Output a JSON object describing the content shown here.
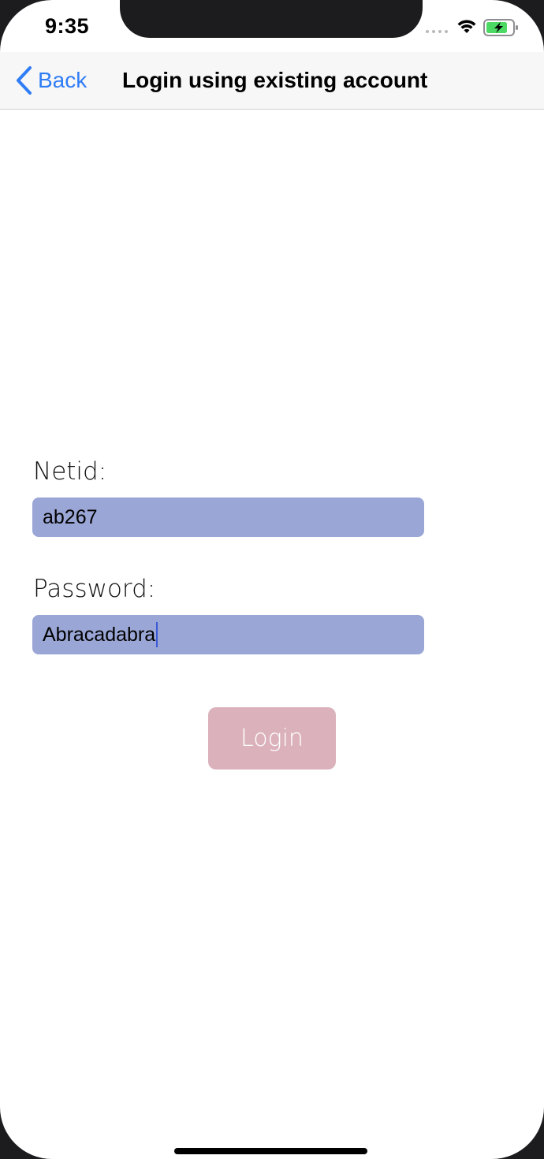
{
  "status_bar": {
    "time": "9:35",
    "battery_color": "#4cd964"
  },
  "nav": {
    "back_label": "Back",
    "title": "Login using existing account",
    "accent_color": "#2f7df6"
  },
  "form": {
    "netid_label": "Netid:",
    "netid_value": "ab267",
    "password_label": "Password:",
    "password_value": "Abracadabra",
    "field_color": "#9aa6d5",
    "login_label": "Login",
    "login_color": "#dbb2bc"
  },
  "icons": {
    "back": "chevron-left-icon",
    "wifi": "wifi-icon",
    "battery": "battery-charging-icon",
    "signal": "signal-dots-icon"
  }
}
